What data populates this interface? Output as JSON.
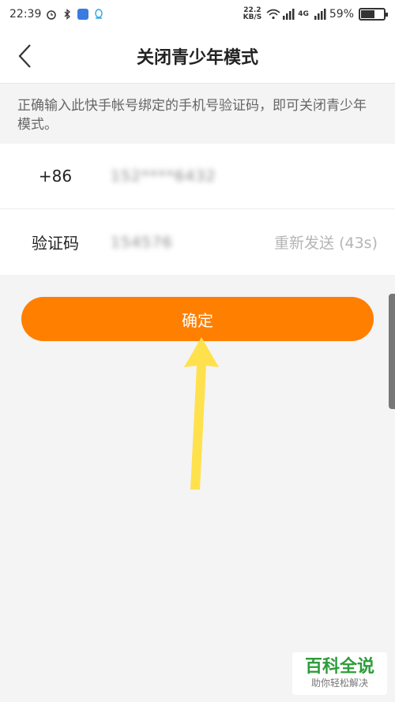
{
  "status_bar": {
    "time": "22:39",
    "speed": "22.2",
    "speed_unit": "KB/S",
    "network": "4G",
    "battery": "59%",
    "battery_level": 0.59
  },
  "nav": {
    "title": "关闭青少年模式"
  },
  "hint": {
    "text": "正确输入此快手帐号绑定的手机号验证码，即可关闭青少年模式。"
  },
  "form": {
    "country_code": "+86",
    "phone_value": "152****6432",
    "code_label": "验证码",
    "code_value": "154576",
    "resend_label": "重新发送 (43s)"
  },
  "confirm_button": {
    "label": "确定"
  },
  "watermark": {
    "main": "百科全说",
    "sub": "助你轻松解决"
  },
  "colors": {
    "accent": "#ff7f00",
    "arrow": "#ffe14d"
  }
}
